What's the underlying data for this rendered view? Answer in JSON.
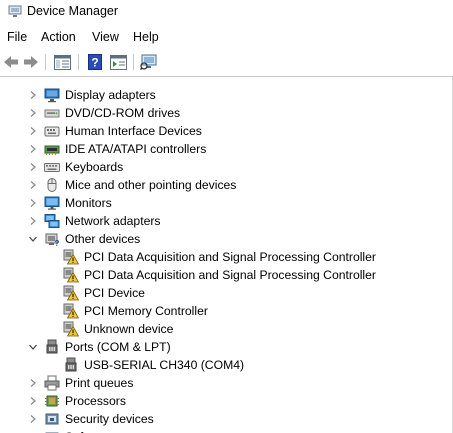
{
  "window": {
    "title": "Device Manager"
  },
  "menu": [
    "File",
    "Action",
    "View",
    "Help"
  ],
  "toolbar": [
    {
      "name": "back-arrow-icon"
    },
    {
      "name": "forward-arrow-icon"
    },
    {
      "name": "show-hide-console-tree-icon"
    },
    {
      "name": "help-icon"
    },
    {
      "name": "properties-icon"
    },
    {
      "name": "scan-for-hardware-changes-icon"
    }
  ],
  "tree": [
    {
      "label": "Display adapters",
      "state": "collapsed",
      "level": 0,
      "icon": "display-adapter-icon"
    },
    {
      "label": "DVD/CD-ROM drives",
      "state": "collapsed",
      "level": 0,
      "icon": "dvd-drive-icon"
    },
    {
      "label": "Human Interface Devices",
      "state": "collapsed",
      "level": 0,
      "icon": "hid-icon"
    },
    {
      "label": "IDE ATA/ATAPI controllers",
      "state": "collapsed",
      "level": 0,
      "icon": "ide-controller-icon"
    },
    {
      "label": "Keyboards",
      "state": "collapsed",
      "level": 0,
      "icon": "keyboard-icon"
    },
    {
      "label": "Mice and other pointing devices",
      "state": "collapsed",
      "level": 0,
      "icon": "mouse-icon"
    },
    {
      "label": "Monitors",
      "state": "collapsed",
      "level": 0,
      "icon": "monitor-icon"
    },
    {
      "label": "Network adapters",
      "state": "collapsed",
      "level": 0,
      "icon": "network-adapter-icon"
    },
    {
      "label": "Other devices",
      "state": "expanded",
      "level": 0,
      "icon": "other-devices-icon"
    },
    {
      "label": "PCI Data Acquisition and Signal Processing Controller",
      "level": 1,
      "icon": "warning-device-icon"
    },
    {
      "label": "PCI Data Acquisition and Signal Processing Controller",
      "level": 1,
      "icon": "warning-device-icon"
    },
    {
      "label": "PCI Device",
      "level": 1,
      "icon": "warning-device-icon"
    },
    {
      "label": "PCI Memory Controller",
      "level": 1,
      "icon": "warning-device-icon"
    },
    {
      "label": "Unknown device",
      "level": 1,
      "icon": "warning-device-icon"
    },
    {
      "label": "Ports (COM & LPT)",
      "state": "expanded",
      "level": 0,
      "icon": "port-icon"
    },
    {
      "label": "USB-SERIAL CH340 (COM4)",
      "level": 1,
      "icon": "port-icon"
    },
    {
      "label": "Print queues",
      "state": "collapsed",
      "level": 0,
      "icon": "printer-icon"
    },
    {
      "label": "Processors",
      "state": "collapsed",
      "level": 0,
      "icon": "processor-icon"
    },
    {
      "label": "Security devices",
      "state": "collapsed",
      "level": 0,
      "icon": "security-device-icon"
    },
    {
      "label": "Software components",
      "state": "collapsed",
      "level": 0,
      "icon": "software-component-icon"
    }
  ]
}
